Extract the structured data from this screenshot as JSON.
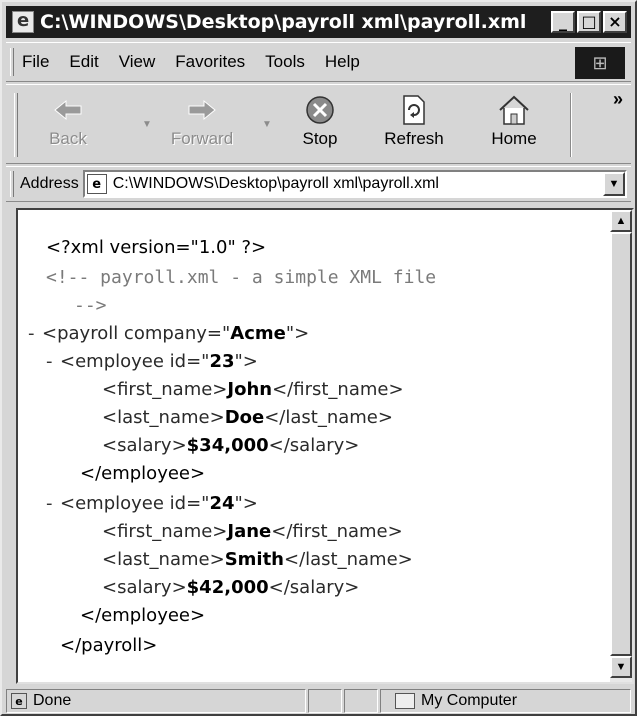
{
  "window": {
    "title": "C:\\WINDOWS\\Desktop\\payroll xml\\payroll.xml",
    "buttons": {
      "minimize": "_",
      "maximize": "□",
      "close": "×"
    }
  },
  "menubar": {
    "items": [
      "File",
      "Edit",
      "View",
      "Favorites",
      "Tools",
      "Help"
    ]
  },
  "toolbar": {
    "back": {
      "label": "Back",
      "icon": "back-arrow-icon",
      "enabled": false
    },
    "forward": {
      "label": "Forward",
      "icon": "forward-arrow-icon",
      "enabled": false
    },
    "stop": {
      "label": "Stop",
      "icon": "stop-icon"
    },
    "refresh": {
      "label": "Refresh",
      "icon": "refresh-icon"
    },
    "home": {
      "label": "Home",
      "icon": "home-icon"
    },
    "more": "»"
  },
  "address": {
    "label": "Address",
    "value": "C:\\WINDOWS\\Desktop\\payroll xml\\payroll.xml"
  },
  "xml": {
    "declaration": "<?xml version=\"1.0\" ?>",
    "comment_line1": "<!--   payroll.xml - a simple XML file",
    "comment_line2": "-->",
    "payroll_open_pre": "<payroll company=\"",
    "company": "Acme",
    "payroll_open_post": "\">",
    "employees": [
      {
        "open_pre": "<employee id=\"",
        "id": "23",
        "open_post": "\">",
        "first_name": "John",
        "last_name": "Doe",
        "salary": "$34,000"
      },
      {
        "open_pre": "<employee id=\"",
        "id": "24",
        "open_post": "\">",
        "first_name": "Jane",
        "last_name": "Smith",
        "salary": "$42,000"
      }
    ],
    "tags": {
      "first_open": "<first_name>",
      "first_close": "</first_name>",
      "last_open": "<last_name>",
      "last_close": "</last_name>",
      "salary_open": "<salary>",
      "salary_close": "</salary>",
      "employee_close": "</employee>",
      "payroll_close": "</payroll>"
    },
    "collapse_marker": "-"
  },
  "statusbar": {
    "status": "Done",
    "zone": "My Computer"
  }
}
